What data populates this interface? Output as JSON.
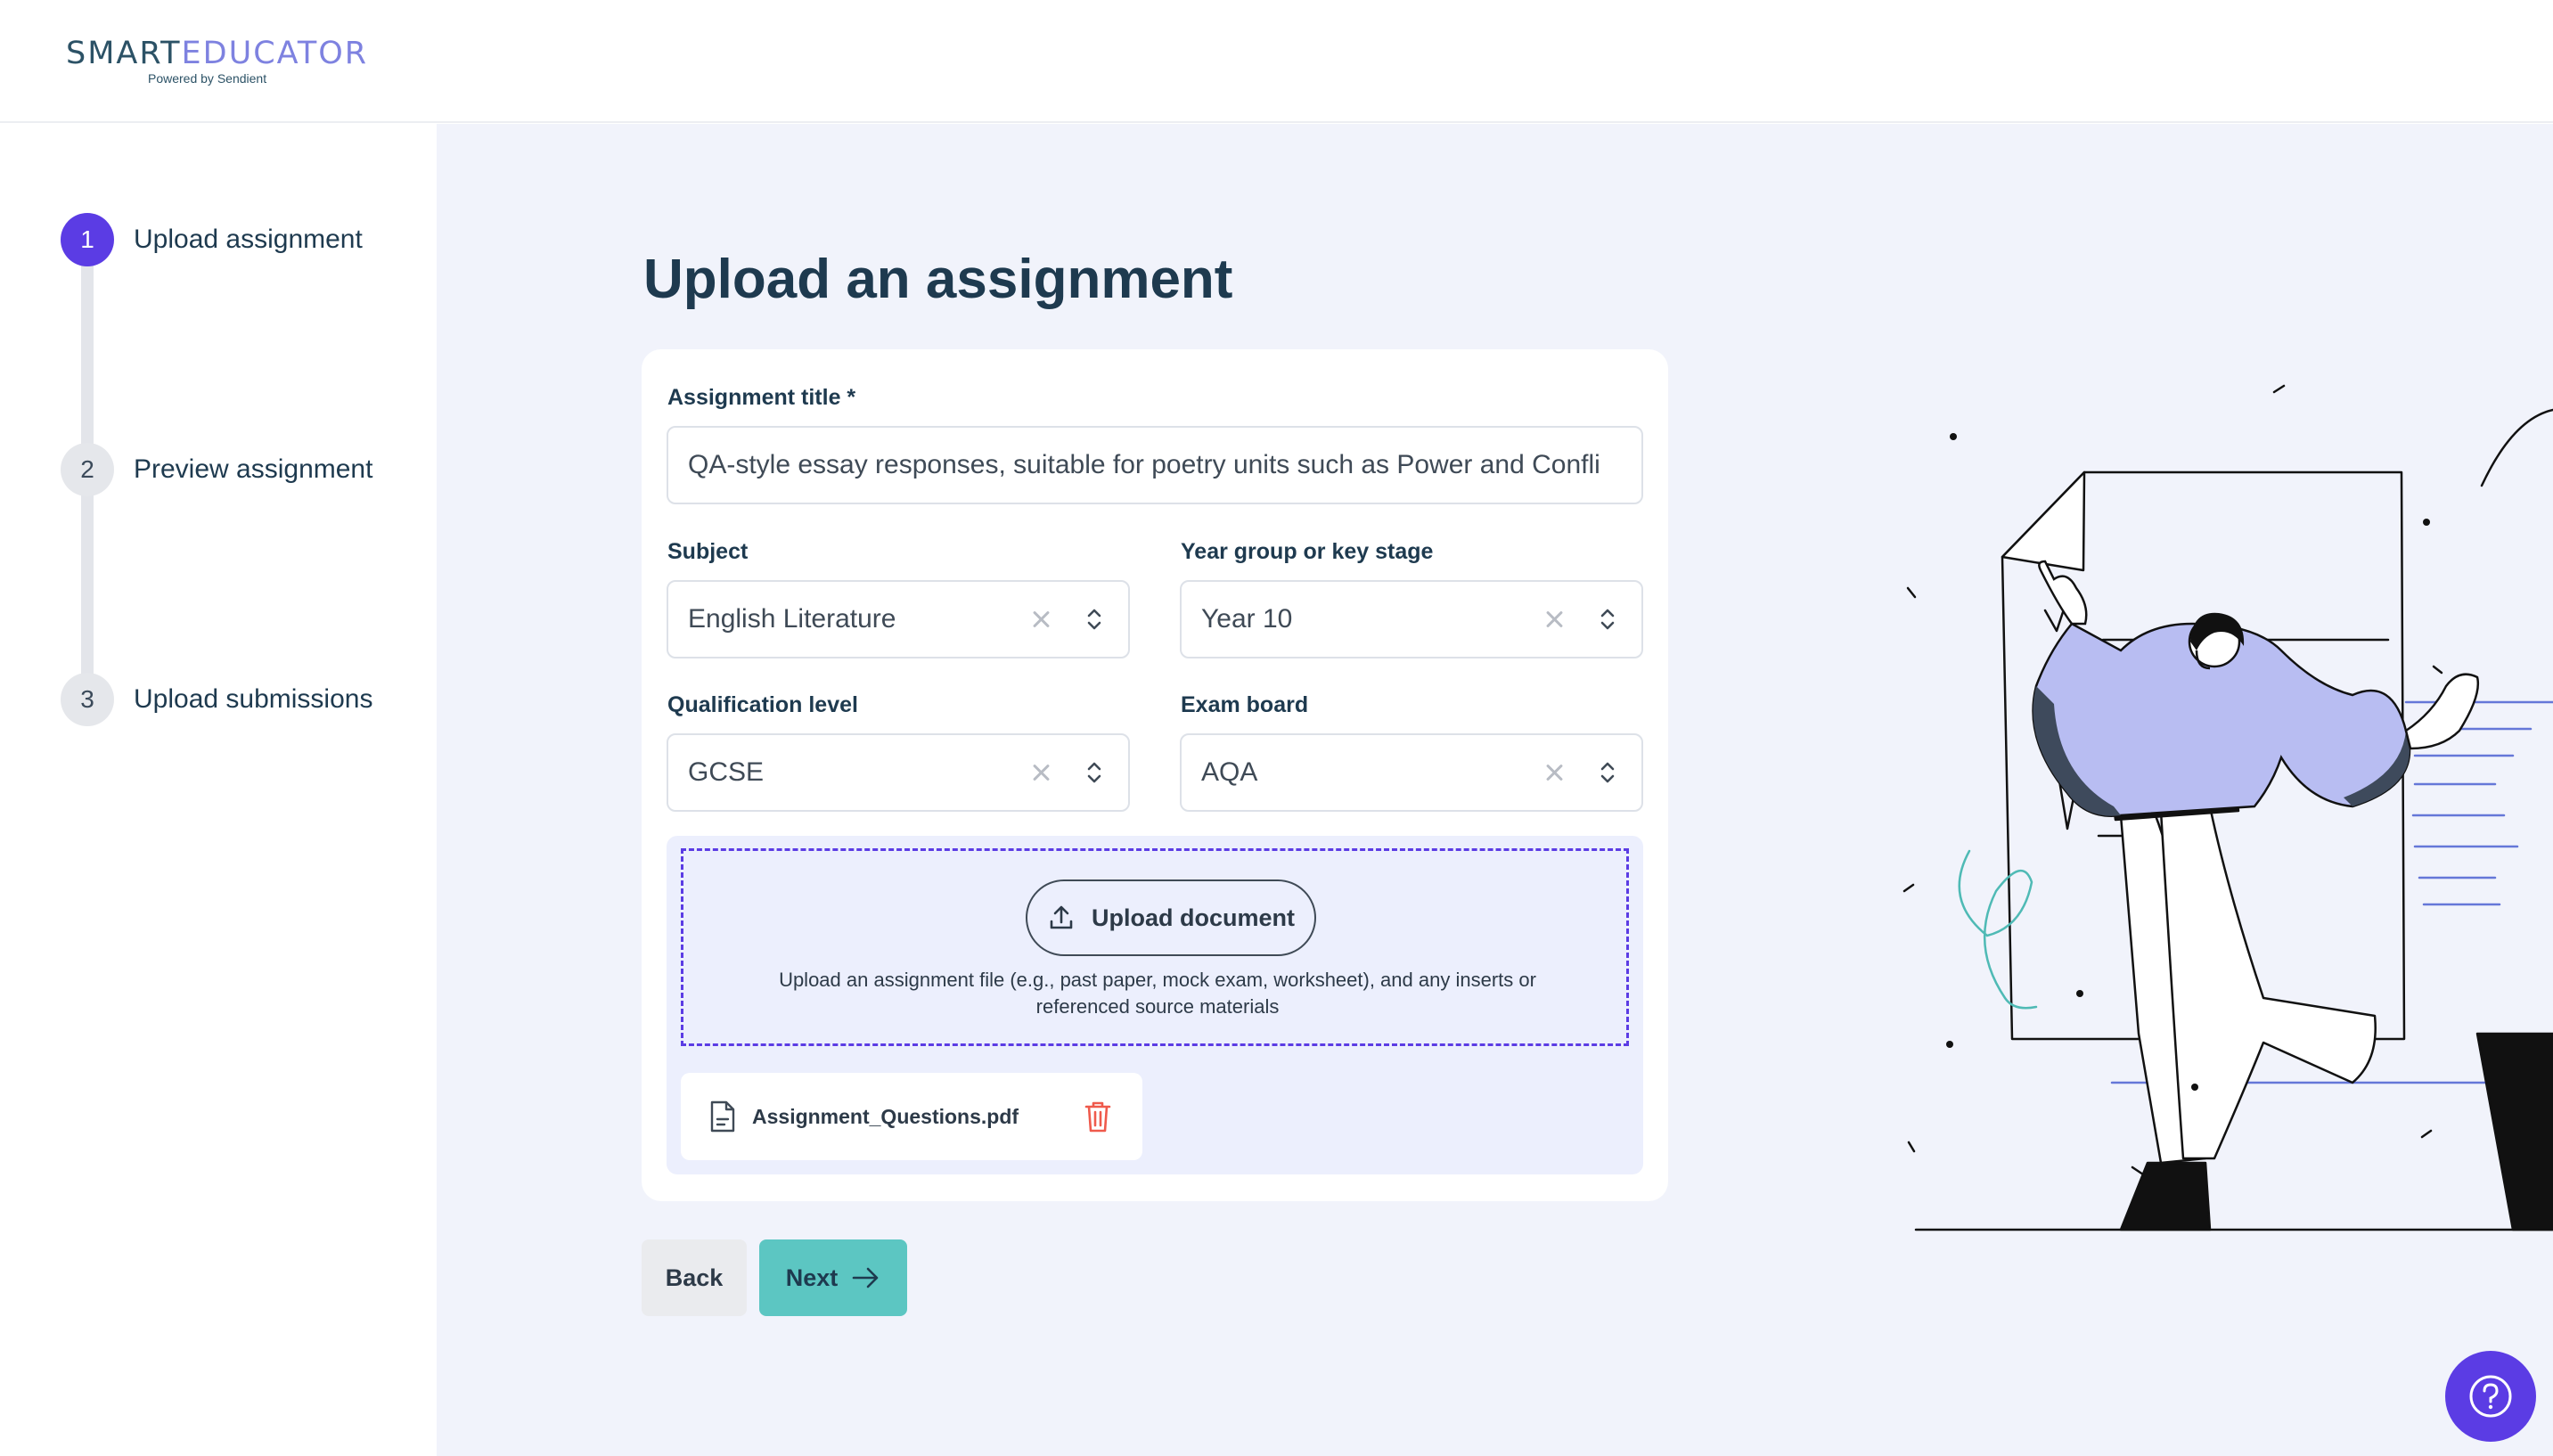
{
  "brand": {
    "logo_smart": "SMART",
    "logo_educator": "EDUCATOR",
    "tagline": "Powered by Sendient",
    "colors": {
      "primary": "#5b3ce4",
      "accent": "#5cc6c2",
      "text": "#1e3a4f"
    }
  },
  "stepper": {
    "steps": [
      {
        "number": "1",
        "label": "Upload assignment",
        "active": true
      },
      {
        "number": "2",
        "label": "Preview assignment",
        "active": false
      },
      {
        "number": "3",
        "label": "Upload submissions",
        "active": false
      }
    ]
  },
  "main": {
    "title": "Upload an assignment",
    "form": {
      "assignment_title": {
        "label": "Assignment title *",
        "value": "QA-style essay responses, suitable for poetry units such as Power and Confli"
      },
      "subject": {
        "label": "Subject",
        "value": "English Literature"
      },
      "year_group": {
        "label": "Year group or key stage",
        "value": "Year 10"
      },
      "qualification": {
        "label": "Qualification level",
        "value": "GCSE"
      },
      "exam_board": {
        "label": "Exam board",
        "value": "AQA"
      }
    },
    "upload": {
      "button_label": "Upload document",
      "help_text": "Upload an assignment file (e.g., past paper, mock exam, worksheet), and any inserts or referenced source materials",
      "files": [
        {
          "name": "Assignment_Questions.pdf",
          "icon": "document-icon"
        }
      ]
    },
    "actions": {
      "back": "Back",
      "next": "Next"
    }
  },
  "icons": {
    "help": "question-circle-icon",
    "upload": "upload-icon",
    "trash": "trash-icon",
    "next": "arrow-right-icon"
  }
}
